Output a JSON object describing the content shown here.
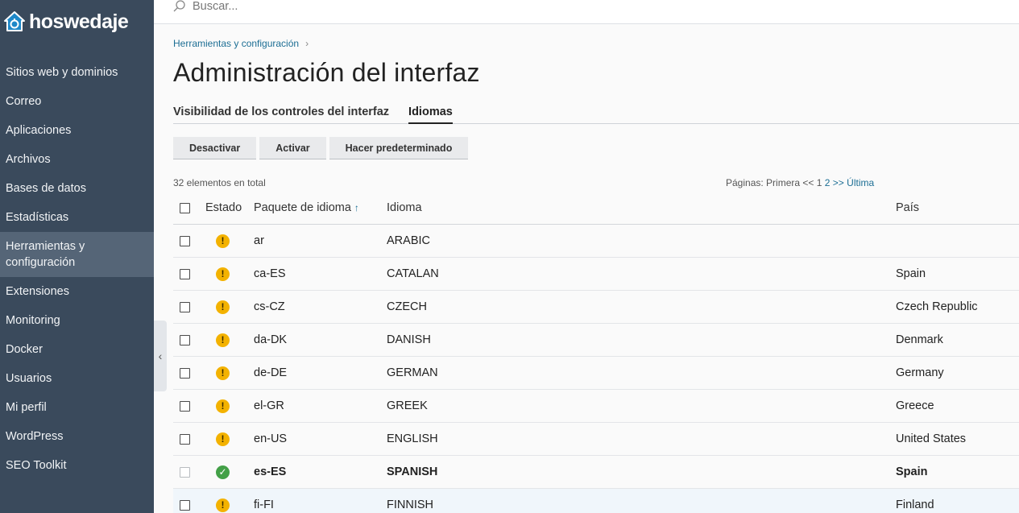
{
  "brand": {
    "name": "hoswedaje"
  },
  "search": {
    "placeholder": "Buscar..."
  },
  "sidebar": {
    "items": [
      {
        "label": "Sitios web y dominios"
      },
      {
        "label": "Correo"
      },
      {
        "label": "Aplicaciones"
      },
      {
        "label": "Archivos"
      },
      {
        "label": "Bases de datos"
      },
      {
        "label": "Estadísticas"
      },
      {
        "label": "Herramientas y configuración"
      },
      {
        "label": "Extensiones"
      },
      {
        "label": "Monitoring"
      },
      {
        "label": "Docker"
      },
      {
        "label": "Usuarios"
      },
      {
        "label": "Mi perfil"
      },
      {
        "label": "WordPress"
      },
      {
        "label": "SEO Toolkit"
      }
    ]
  },
  "breadcrumb": {
    "item": "Herramientas y configuración"
  },
  "page": {
    "title": "Administración del interfaz"
  },
  "tabs": [
    {
      "label": "Visibilidad de los controles del interfaz"
    },
    {
      "label": "Idiomas"
    }
  ],
  "toolbar": {
    "deactivate": "Desactivar",
    "activate": "Activar",
    "make_default": "Hacer predeterminado"
  },
  "list": {
    "total": "32 elementos en total",
    "pager": {
      "prefix": "Páginas: Primera <<",
      "page1": "1",
      "page2": "2",
      "next": ">>",
      "last": "Última"
    }
  },
  "table": {
    "columns": {
      "estado": "Estado",
      "paquete": "Paquete de idioma",
      "idioma": "Idioma",
      "pais": "País"
    },
    "rows": [
      {
        "paquete": "ar",
        "idioma": "ARABIC",
        "pais": "",
        "status": "warning"
      },
      {
        "paquete": "ca-ES",
        "idioma": "CATALAN",
        "pais": "Spain",
        "status": "warning"
      },
      {
        "paquete": "cs-CZ",
        "idioma": "CZECH",
        "pais": "Czech Republic",
        "status": "warning"
      },
      {
        "paquete": "da-DK",
        "idioma": "DANISH",
        "pais": "Denmark",
        "status": "warning"
      },
      {
        "paquete": "de-DE",
        "idioma": "GERMAN",
        "pais": "Germany",
        "status": "warning"
      },
      {
        "paquete": "el-GR",
        "idioma": "GREEK",
        "pais": "Greece",
        "status": "warning"
      },
      {
        "paquete": "en-US",
        "idioma": "ENGLISH",
        "pais": "United States",
        "status": "warning"
      },
      {
        "paquete": "es-ES",
        "idioma": "SPANISH",
        "pais": "Spain",
        "status": "ok"
      },
      {
        "paquete": "fi-FI",
        "idioma": "FINNISH",
        "pais": "Finland",
        "status": "warning"
      }
    ]
  },
  "colors": {
    "sidebar": "#3a4a5c",
    "sidebar_active": "#556577",
    "link": "#1c6e94",
    "warning": "#f3b200",
    "ok": "#43a047"
  }
}
